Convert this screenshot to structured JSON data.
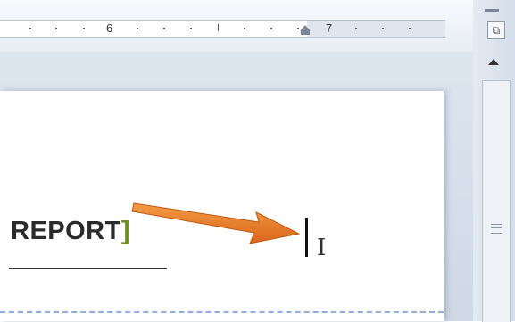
{
  "ruler": {
    "number_6": "6",
    "number_7": "7"
  },
  "document": {
    "heading_text": "REPORT",
    "bracket": "]",
    "ibeam": "I"
  },
  "scrollbar": {
    "view_icon": "view-ruler-icon"
  },
  "colors": {
    "arrow": "#e87722",
    "dashed_line": "#8fb0de",
    "bracket": "#6b8e23"
  }
}
